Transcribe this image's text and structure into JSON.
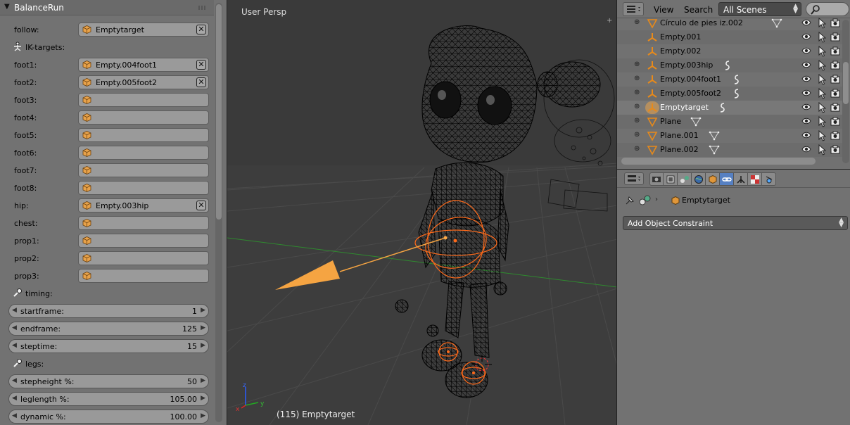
{
  "panel": {
    "title": "BalanceRun",
    "follow_label": "follow:",
    "follow_value": "Emptytarget",
    "ik_section": "IK-targets:",
    "fields": [
      {
        "label": "foot1:",
        "value": "Empty.004foot1",
        "clear": true
      },
      {
        "label": "foot2:",
        "value": "Empty.005foot2",
        "clear": true
      },
      {
        "label": "foot3:",
        "value": "",
        "clear": false
      },
      {
        "label": "foot4:",
        "value": "",
        "clear": false
      },
      {
        "label": "foot5:",
        "value": "",
        "clear": false
      },
      {
        "label": "foot6:",
        "value": "",
        "clear": false
      },
      {
        "label": "foot7:",
        "value": "",
        "clear": false
      },
      {
        "label": "foot8:",
        "value": "",
        "clear": false
      },
      {
        "label": "hip:",
        "value": "Empty.003hip",
        "clear": true
      },
      {
        "label": "chest:",
        "value": "",
        "clear": false
      },
      {
        "label": "prop1:",
        "value": "",
        "clear": false
      },
      {
        "label": "prop2:",
        "value": "",
        "clear": false
      },
      {
        "label": "prop3:",
        "value": "",
        "clear": false
      }
    ],
    "timing_section": "timing:",
    "timing": [
      {
        "label": "startframe:",
        "value": "1"
      },
      {
        "label": "endframe:",
        "value": "125"
      },
      {
        "label": "steptime:",
        "value": "15"
      }
    ],
    "legs_section": "legs:",
    "legs": [
      {
        "label": "stepheight %:",
        "value": "50"
      },
      {
        "label": "leglength %:",
        "value": "105.00"
      },
      {
        "label": "dynamic %:",
        "value": "100.00"
      }
    ]
  },
  "viewport": {
    "title": "User Persp",
    "status": "(115) Emptytarget"
  },
  "outliner": {
    "menu_view": "View",
    "menu_search": "Search",
    "scenes_value": "All Scenes",
    "rows": [
      {
        "name": "Círculo de  pies iz.002",
        "icon": "mesh-icon",
        "extra": "mesh-data-icon"
      },
      {
        "name": "Empty.001",
        "icon": "empty-icon",
        "extra": ""
      },
      {
        "name": "Empty.002",
        "icon": "empty-icon",
        "extra": ""
      },
      {
        "name": "Empty.003hip",
        "icon": "empty-icon",
        "extra": "constraint-icon"
      },
      {
        "name": "Empty.004foot1",
        "icon": "empty-icon",
        "extra": "constraint-icon"
      },
      {
        "name": "Empty.005foot2",
        "icon": "empty-icon",
        "extra": "constraint-icon"
      },
      {
        "name": "Emptytarget",
        "icon": "empty-icon",
        "extra": "constraint-icon"
      },
      {
        "name": "Plane",
        "icon": "mesh-icon",
        "extra": "mesh-data-icon"
      },
      {
        "name": "Plane.001",
        "icon": "mesh-icon",
        "extra": "mesh-data-icon"
      },
      {
        "name": "Plane.002",
        "icon": "mesh-icon",
        "extra": "mesh-data-icon"
      }
    ]
  },
  "properties": {
    "breadcrumb_object": "Emptytarget",
    "add_constraint": "Add Object Constraint"
  },
  "colors": {
    "accent": "#f5a442",
    "selection": "#ff6a00",
    "active_tab": "#5680c2"
  }
}
